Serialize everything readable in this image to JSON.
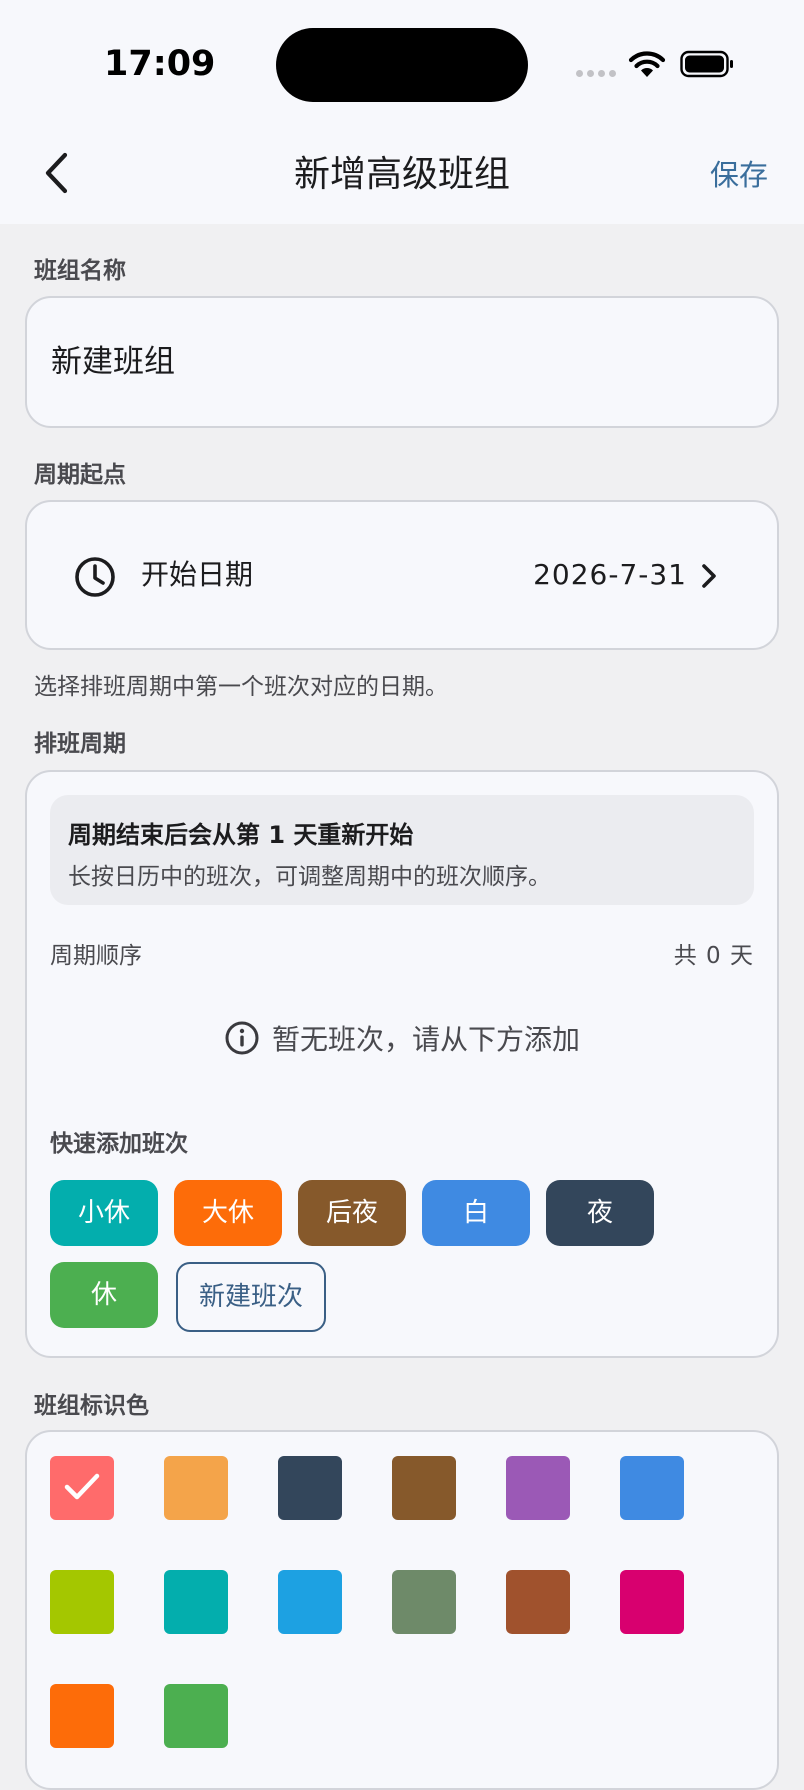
{
  "status_bar": {
    "time": "17:09"
  },
  "nav": {
    "title": "新增高级班组",
    "save_label": "保存"
  },
  "group_name": {
    "label": "班组名称",
    "value": "新建班组"
  },
  "cycle_start": {
    "label": "周期起点",
    "row_label": "开始日期",
    "date_value": "2026-7-31",
    "helper": "选择排班周期中第一个班次对应的日期。"
  },
  "schedule_cycle": {
    "label": "排班周期",
    "info_title": "周期结束后会从第 1 天重新开始",
    "info_sub": "长按日历中的班次，可调整周期中的班次顺序。",
    "order_label": "周期顺序",
    "count_text": "共 0 天",
    "empty_text": "暂无班次，请从下方添加",
    "quick_add_label": "快速添加班次",
    "chips": [
      {
        "label": "小休",
        "color": "#03aead"
      },
      {
        "label": "大休",
        "color": "#fd6c09"
      },
      {
        "label": "后夜",
        "color": "#86592b"
      },
      {
        "label": "白",
        "color": "#3f8ae2"
      },
      {
        "label": "夜",
        "color": "#33465b"
      },
      {
        "label": "休",
        "color": "#4caf50"
      }
    ],
    "new_shift_label": "新建班次"
  },
  "group_color": {
    "label": "班组标识色",
    "selected": "#ff6b6b",
    "swatches": [
      "#ff6b6b",
      "#f4a44a",
      "#33465b",
      "#86592b",
      "#9b59b6",
      "#3f8ae2",
      "#a4c700",
      "#03aead",
      "#1da1e2",
      "#6e8a69",
      "#a0522d",
      "#d8006f",
      "#fd6c09",
      "#4caf50"
    ]
  }
}
